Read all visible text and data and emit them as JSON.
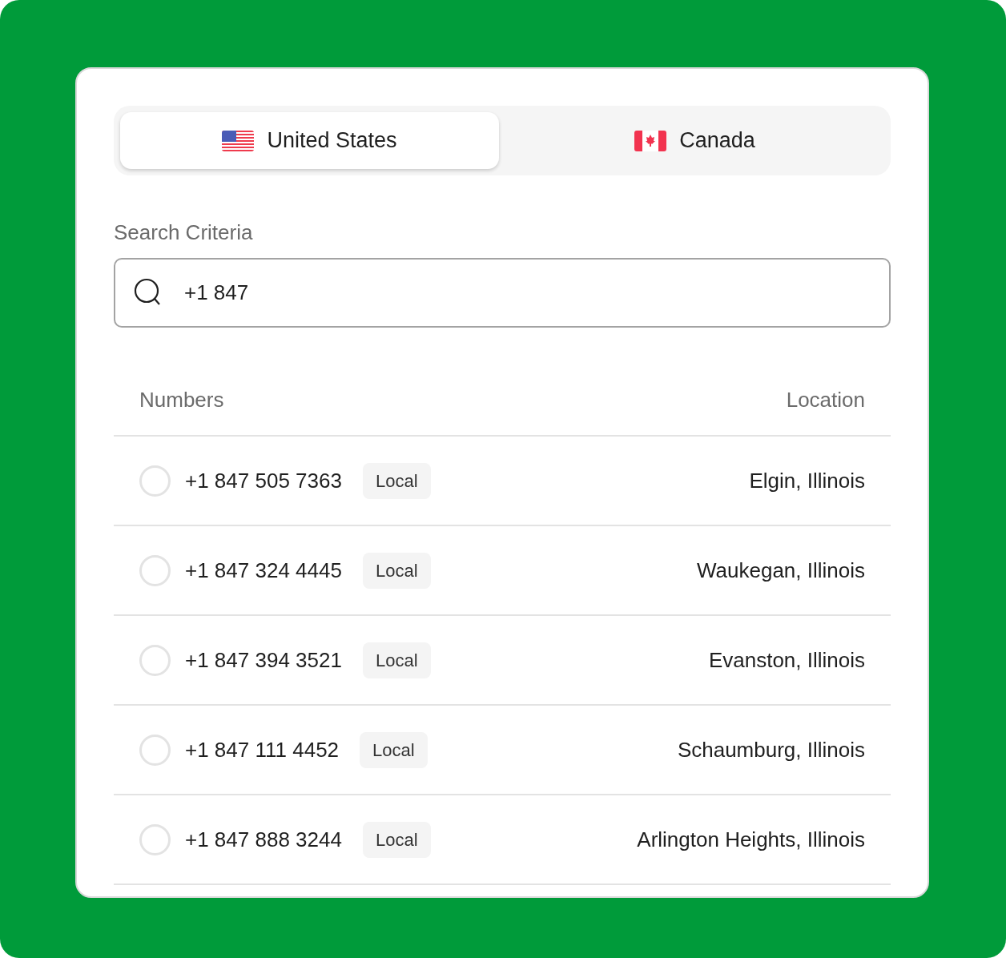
{
  "tabs": [
    {
      "label": "United States",
      "kind": "us",
      "selected": true
    },
    {
      "label": "Canada",
      "kind": "ca",
      "selected": false
    }
  ],
  "search": {
    "label": "Search Criteria",
    "value": "+1 847"
  },
  "table": {
    "columns": [
      "Numbers",
      "Location"
    ],
    "rows": [
      {
        "number": "+1 847 505 7363",
        "tag": "Local",
        "location": "Elgin, Illinois",
        "selected": false
      },
      {
        "number": "+1 847 324 4445",
        "tag": "Local",
        "location": "Waukegan, Illinois",
        "selected": false
      },
      {
        "number": "+1 847 394 3521",
        "tag": "Local",
        "location": "Evanston, Illinois",
        "selected": false
      },
      {
        "number": "+1 847 111 4452",
        "tag": "Local",
        "location": "Schaumburg, Illinois",
        "selected": false
      },
      {
        "number": "+1 847 888 3244",
        "tag": "Local",
        "location": "Arlington Heights, Illinois",
        "selected": false
      }
    ]
  }
}
